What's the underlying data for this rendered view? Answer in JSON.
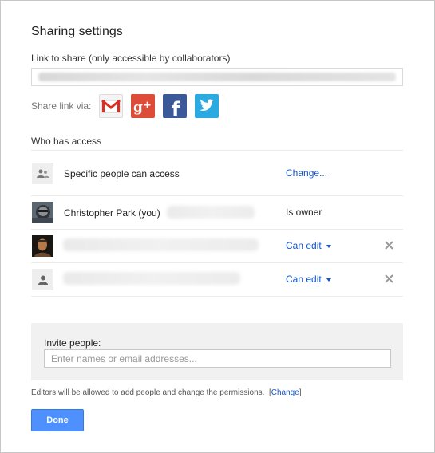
{
  "dialog": {
    "title": "Sharing settings",
    "link_label": "Link to share (only accessible by collaborators)",
    "share_via_label": "Share link via:",
    "social": [
      "gmail-icon",
      "google-plus-icon",
      "facebook-icon",
      "twitter-icon"
    ]
  },
  "access": {
    "header": "Who has access",
    "visibility": {
      "label": "Specific people can access",
      "action": "Change..."
    },
    "people": [
      {
        "name": "Christopher Park (you)",
        "role": "Is owner"
      },
      {
        "name": "",
        "role": "Can edit"
      },
      {
        "name": "",
        "role": "Can edit"
      }
    ]
  },
  "invite": {
    "label": "Invite people:",
    "placeholder": "Enter names or email addresses..."
  },
  "footer": {
    "note": "Editors will be allowed to add people and change the permissions.",
    "change_link": "Change",
    "done_label": "Done"
  },
  "colors": {
    "link": "#1155cc",
    "done_button": "#4d90fe"
  }
}
